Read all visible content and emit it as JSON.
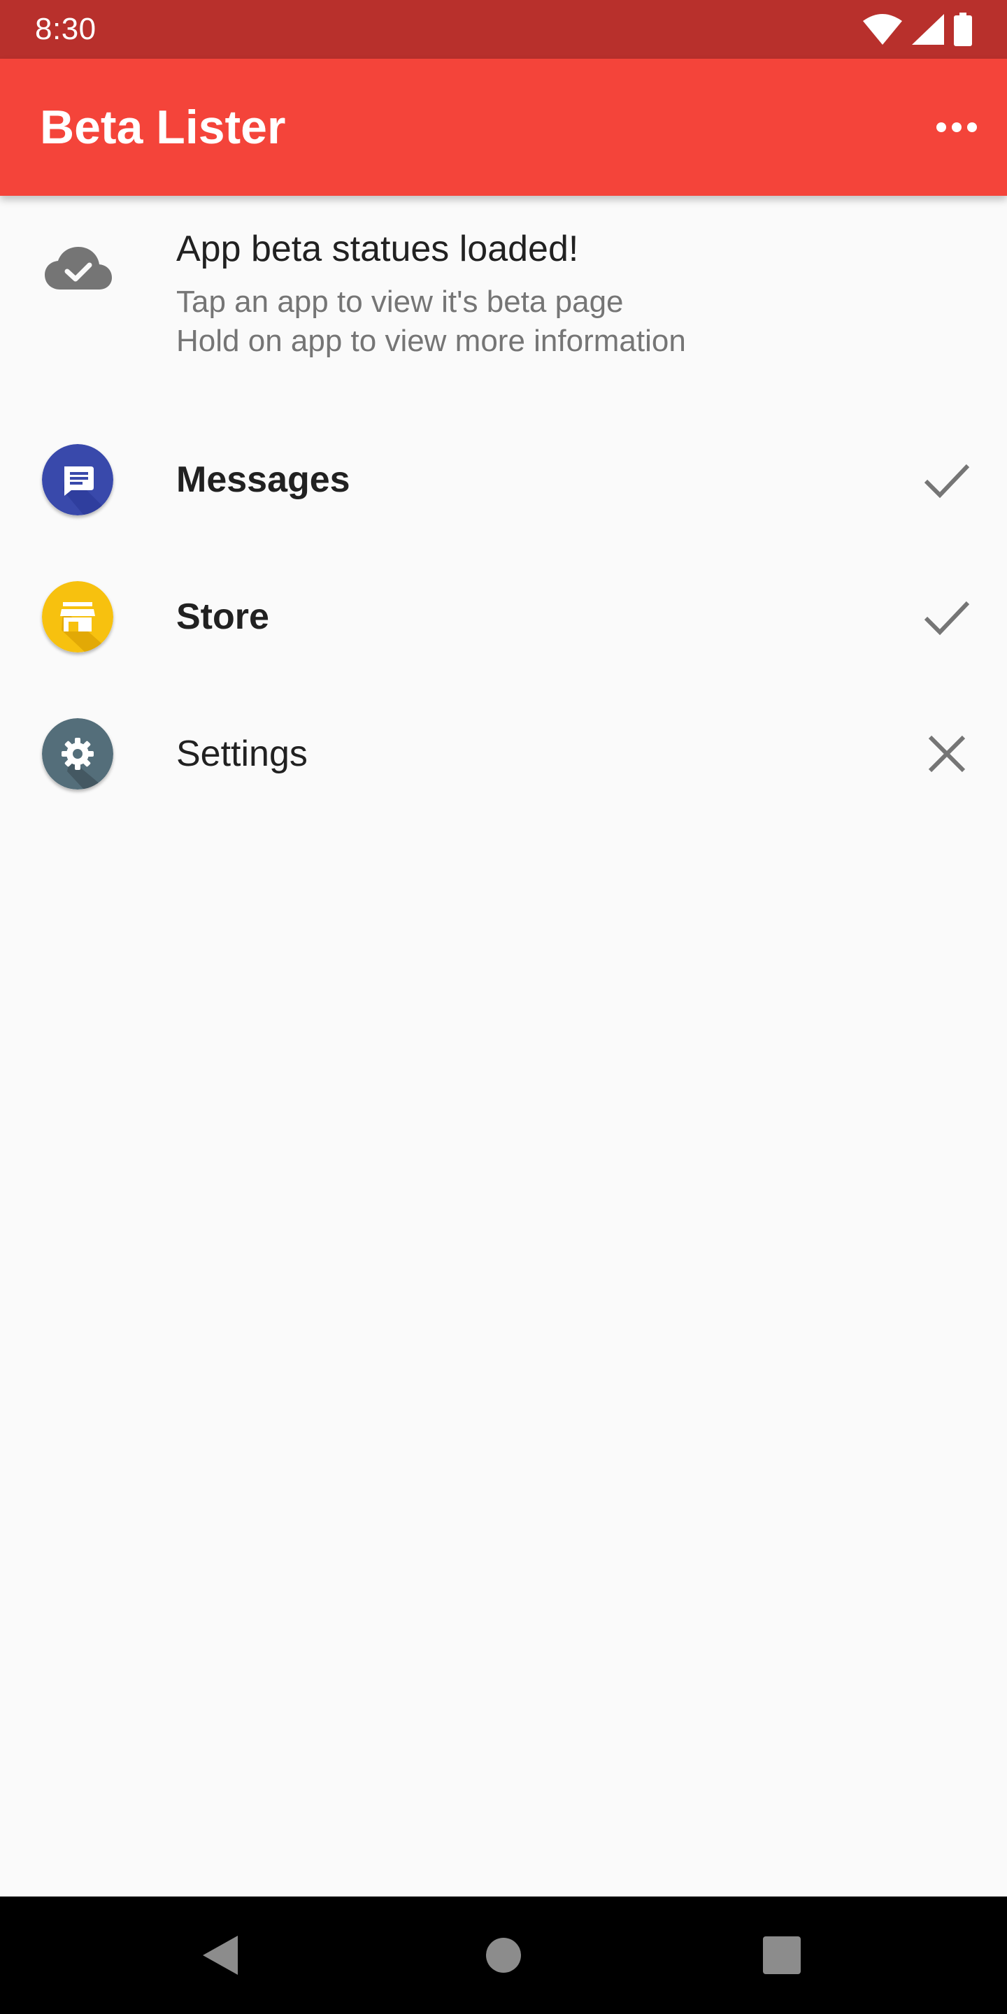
{
  "status_bar": {
    "time": "8:30",
    "icons": [
      "wifi-icon",
      "signal-icon",
      "battery-icon"
    ]
  },
  "app_bar": {
    "title": "Beta Lister",
    "menu_icon": "more-horizontal-icon",
    "color": "#f4443a"
  },
  "info": {
    "icon": "cloud-done-icon",
    "title": "App beta statues loaded!",
    "line1": "Tap an app to view it's beta page",
    "line2": "Hold on app to view more information"
  },
  "apps": [
    {
      "name": "Messages",
      "icon": "message-icon",
      "color": "#3949ab",
      "status": "check-icon"
    },
    {
      "name": "Store",
      "icon": "store-icon",
      "color": "#f7b90b",
      "status": "check-icon"
    },
    {
      "name": "Settings",
      "icon": "gear-icon",
      "color": "#546e7a",
      "status": "close-icon"
    }
  ],
  "nav_bar": {
    "buttons": [
      "back-icon",
      "home-icon",
      "recents-icon"
    ]
  }
}
